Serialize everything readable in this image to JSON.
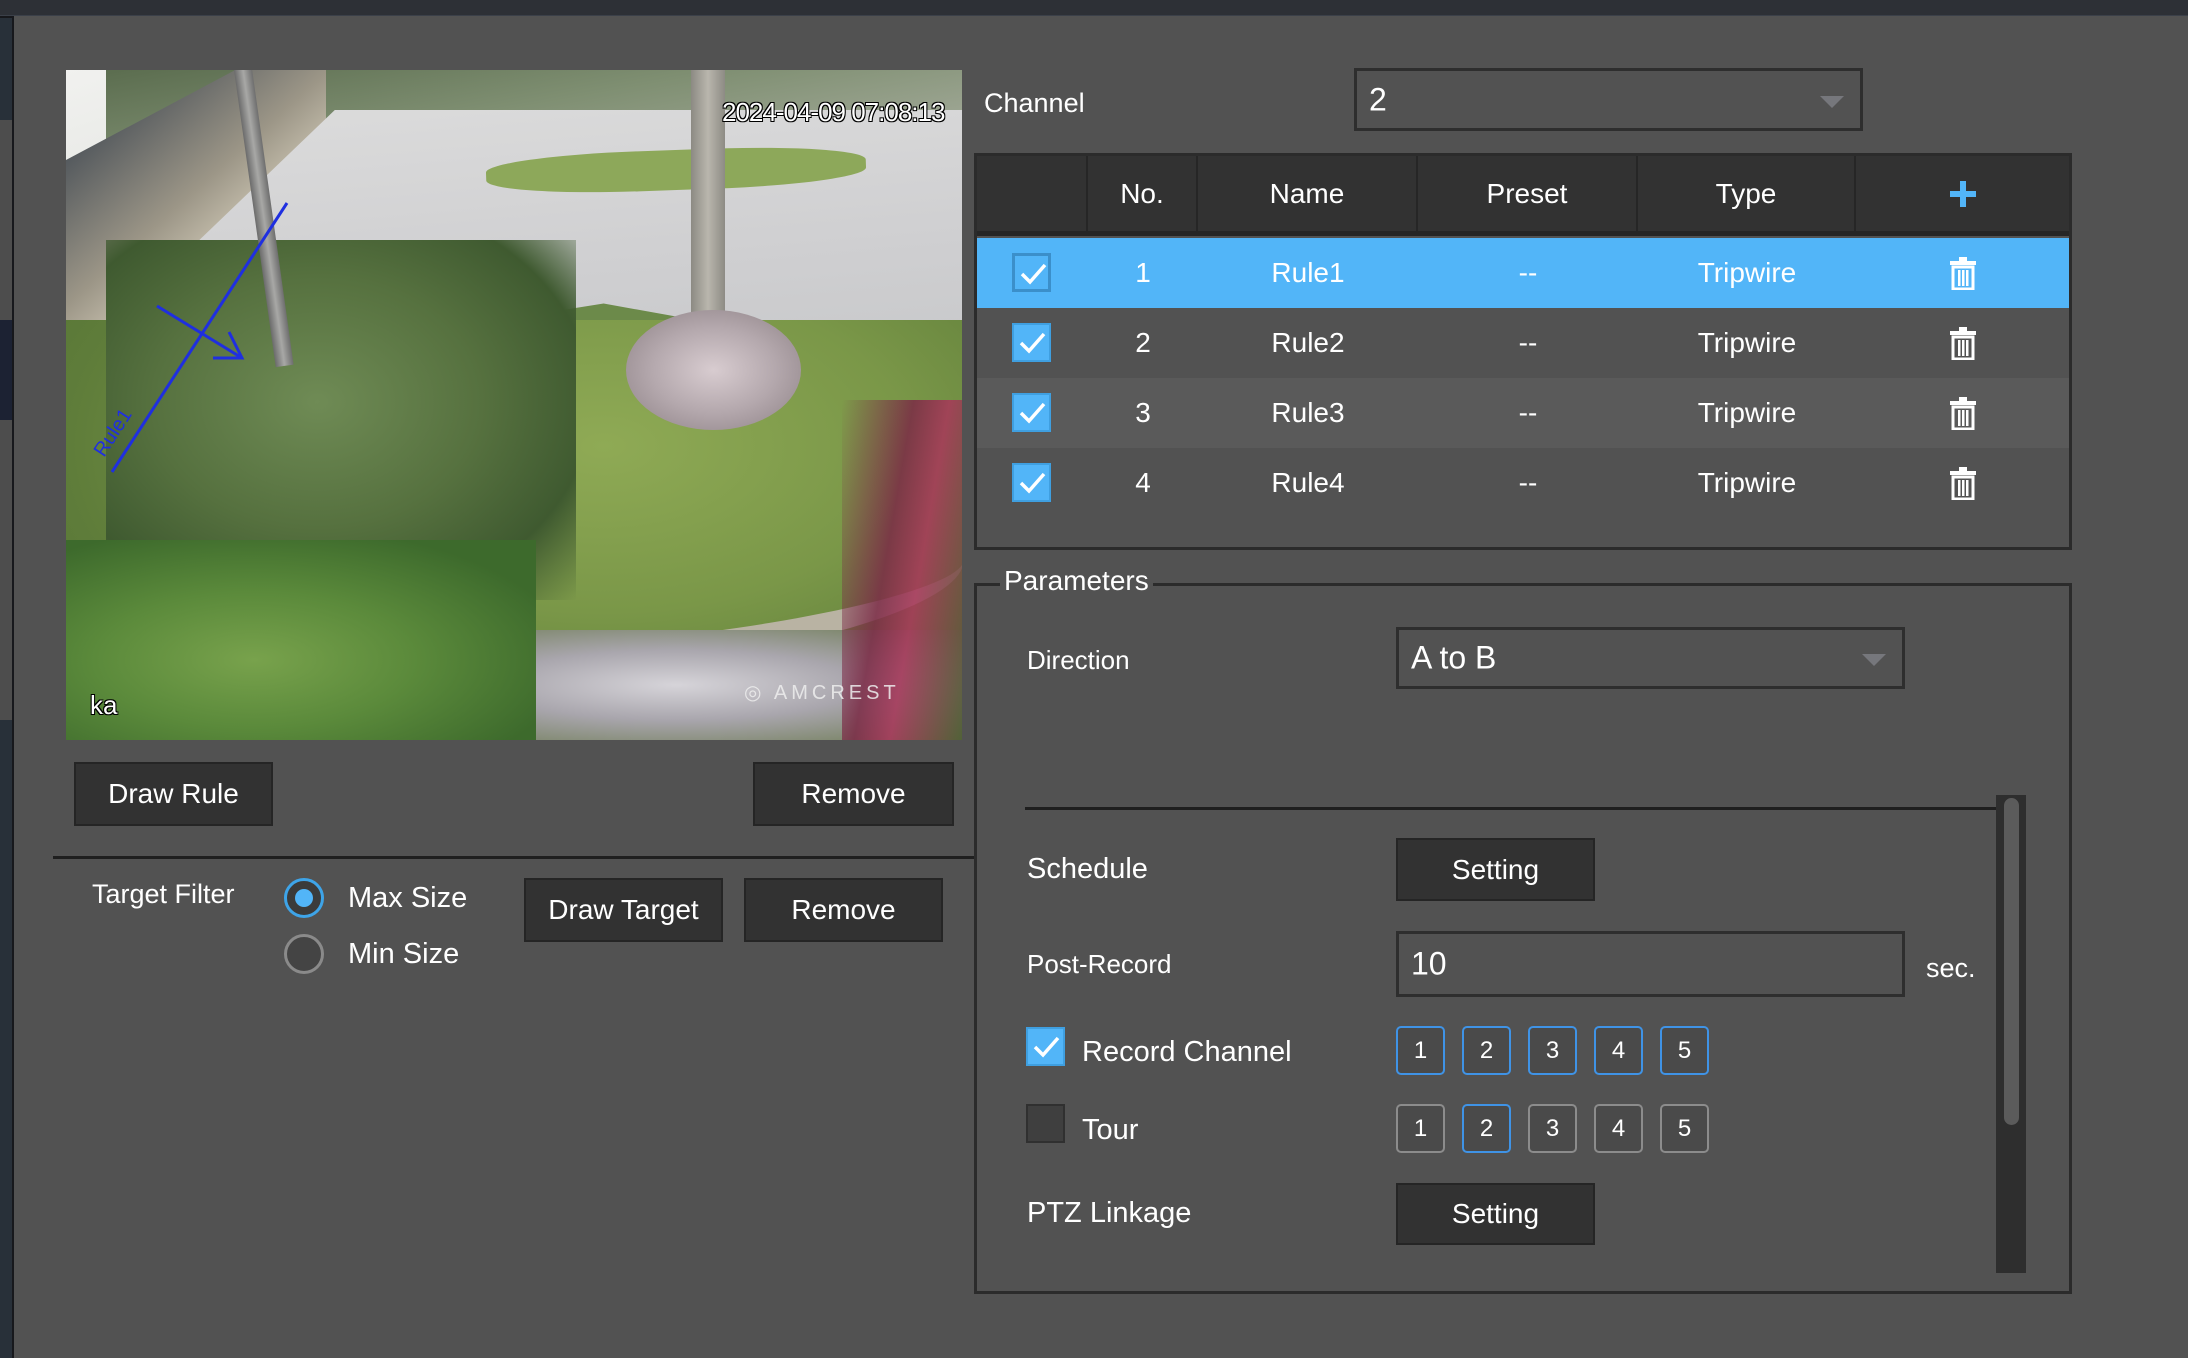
{
  "colors": {
    "accent": "#52b5f8",
    "background": "#525252",
    "header_bg": "#323232",
    "button_bg": "#323232",
    "overlay_line": "#1f2fe0"
  },
  "video": {
    "timestamp": "2024-04-09 07:08:13",
    "camera_label": "ka",
    "watermark": "AMCREST",
    "rule_overlay_label": "Rule1"
  },
  "rule_controls": {
    "draw_rule": "Draw Rule",
    "remove": "Remove"
  },
  "target_filter": {
    "label": "Target Filter",
    "options": [
      {
        "label": "Max Size",
        "selected": true
      },
      {
        "label": "Min Size",
        "selected": false
      }
    ],
    "draw_target": "Draw Target",
    "remove": "Remove"
  },
  "channel": {
    "label": "Channel",
    "value": "2"
  },
  "rules_table": {
    "columns": [
      "",
      "No.",
      "Name",
      "Preset",
      "Type",
      "+"
    ],
    "add_icon": "plus-icon",
    "rows": [
      {
        "checked": true,
        "no": "1",
        "name": "Rule1",
        "preset": "--",
        "type": "Tripwire",
        "selected": true
      },
      {
        "checked": true,
        "no": "2",
        "name": "Rule2",
        "preset": "--",
        "type": "Tripwire",
        "selected": false
      },
      {
        "checked": true,
        "no": "3",
        "name": "Rule3",
        "preset": "--",
        "type": "Tripwire",
        "selected": false
      },
      {
        "checked": true,
        "no": "4",
        "name": "Rule4",
        "preset": "--",
        "type": "Tripwire",
        "selected": false
      }
    ]
  },
  "parameters": {
    "legend": "Parameters",
    "direction": {
      "label": "Direction",
      "value": "A to B"
    },
    "schedule": {
      "label": "Schedule",
      "button": "Setting"
    },
    "post_record": {
      "label": "Post-Record",
      "value": "10",
      "unit": "sec."
    },
    "record_channel": {
      "label": "Record Channel",
      "checked": true,
      "channels": [
        {
          "label": "1",
          "active": true
        },
        {
          "label": "2",
          "active": true
        },
        {
          "label": "3",
          "active": true
        },
        {
          "label": "4",
          "active": true
        },
        {
          "label": "5",
          "active": true
        }
      ]
    },
    "tour": {
      "label": "Tour",
      "checked": false,
      "channels": [
        {
          "label": "1",
          "active": false
        },
        {
          "label": "2",
          "active": true
        },
        {
          "label": "3",
          "active": false
        },
        {
          "label": "4",
          "active": false
        },
        {
          "label": "5",
          "active": false
        }
      ]
    },
    "ptz_linkage": {
      "label": "PTZ Linkage",
      "button": "Setting"
    }
  }
}
